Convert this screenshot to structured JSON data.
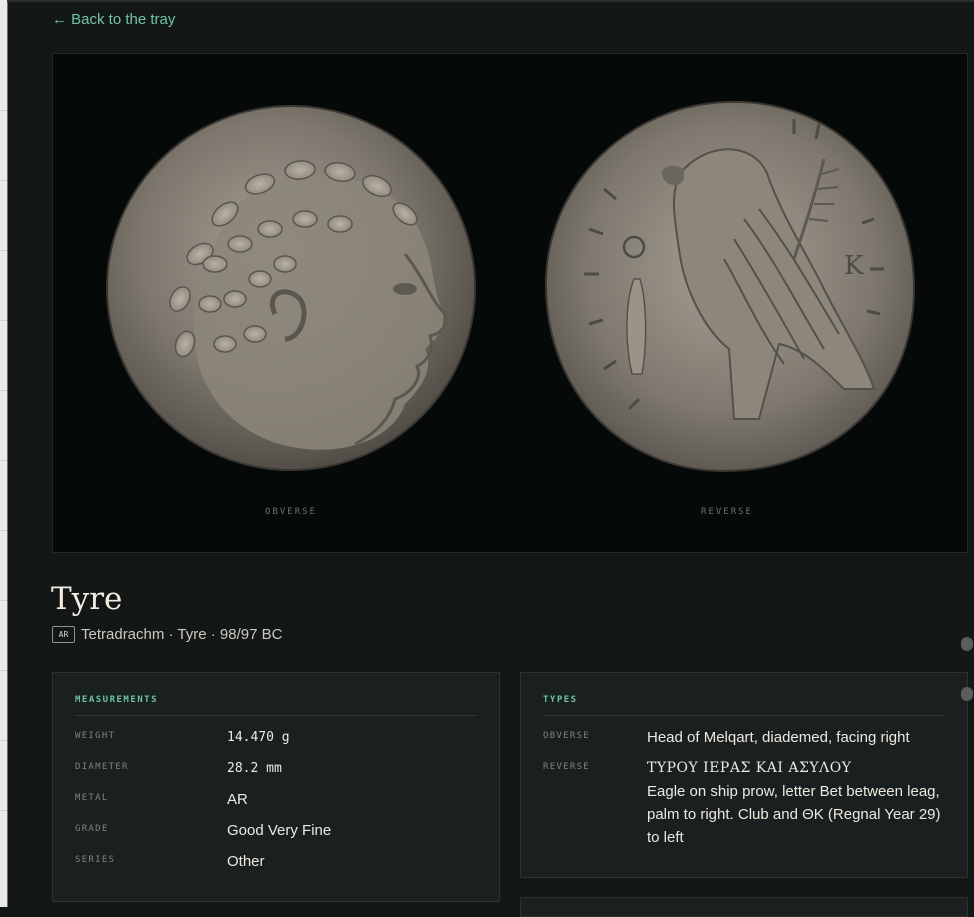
{
  "nav": {
    "back_label": "← Back to the tray"
  },
  "coin_images": {
    "obverse_label": "OBVERSE",
    "reverse_label": "REVERSE"
  },
  "coin": {
    "title": "Tyre",
    "metal_badge": "AR",
    "subtitle": "Tetradrachm · Tyre · 98/97 BC"
  },
  "measurements": {
    "heading": "MEASUREMENTS",
    "rows": [
      {
        "key": "WEIGHT",
        "value": "14.470 g"
      },
      {
        "key": "DIAMETER",
        "value": "28.2 mm"
      },
      {
        "key": "METAL",
        "value": "AR"
      },
      {
        "key": "GRADE",
        "value": "Good Very Fine"
      },
      {
        "key": "SERIES",
        "value": "Other"
      }
    ]
  },
  "types": {
    "heading": "TYPES",
    "obverse_key": "OBVERSE",
    "obverse_value": "Head of Melqart, diademed, facing right",
    "reverse_key": "REVERSE",
    "reverse_legend": "ΤΥΡΟΥ ΙΕΡΑΣ ΚΑΙ ΑΣΥΛΟΥ",
    "reverse_description": "Eagle on ship prow, letter Bet between leag, palm to right. Club and ΘΚ (Regnal Year 29) to left"
  },
  "colors": {
    "accent": "#6fc3a3",
    "background": "#131817",
    "panel": "#1a201f",
    "coin_stage": "#050908"
  }
}
